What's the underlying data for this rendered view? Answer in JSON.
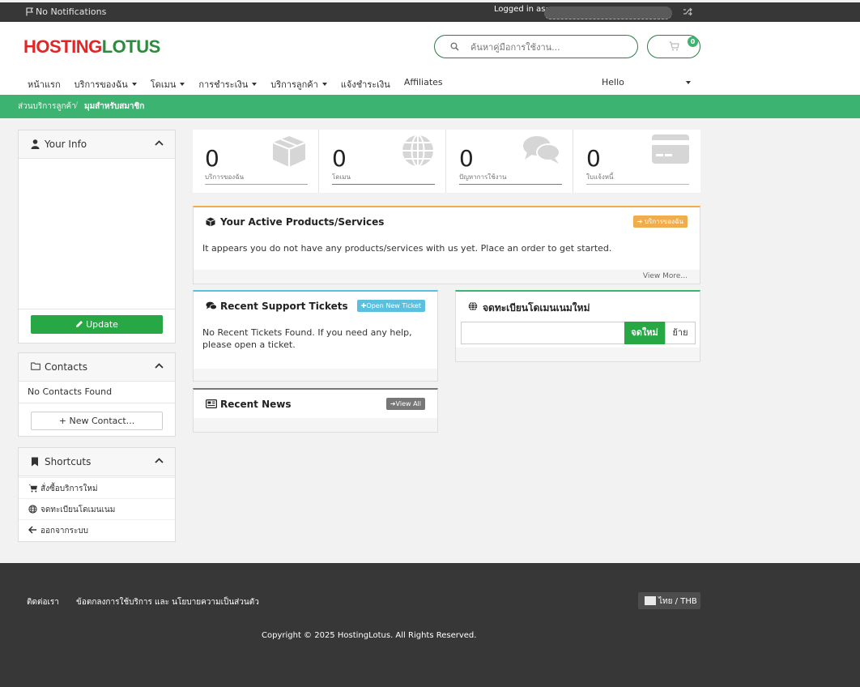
{
  "topbar": {
    "notifications": "No Notifications",
    "logged_in_as": "Logged in as:"
  },
  "brand": {
    "part1": "HOSTING",
    "part2": "LOTUS"
  },
  "search": {
    "placeholder": "ค้นหาคู่มือการใช้งาน..."
  },
  "cart": {
    "count": "0"
  },
  "nav": {
    "items": [
      {
        "label": "หน้าแรก",
        "dropdown": false
      },
      {
        "label": "บริการของฉัน",
        "dropdown": true
      },
      {
        "label": "โดเมน",
        "dropdown": true
      },
      {
        "label": "การชำระเงิน",
        "dropdown": true
      },
      {
        "label": "บริการลูกค้า",
        "dropdown": true
      },
      {
        "label": "แจ้งชำระเงิน",
        "dropdown": false
      },
      {
        "label": "Affiliates",
        "dropdown": false
      }
    ],
    "hello": "Hello"
  },
  "breadcrumb": {
    "parent": "ส่วนบริการลูกค้า",
    "current": "มุมสำหรับสมาชิก"
  },
  "sidebar": {
    "info": {
      "title": "Your Info",
      "update_label": "Update"
    },
    "contacts": {
      "title": "Contacts",
      "empty": "No Contacts Found",
      "new_label": "+ New Contact..."
    },
    "shortcuts": {
      "title": "Shortcuts",
      "items": [
        {
          "label": "สั่งซื้อบริการใหม่",
          "icon": "cart-icon"
        },
        {
          "label": "จดทะเบียนโดเมนเนม",
          "icon": "globe-icon"
        },
        {
          "label": "ออกจากระบบ",
          "icon": "arrow-left-icon"
        }
      ]
    }
  },
  "stats": [
    {
      "value": "0",
      "label": "บริการของฉัน",
      "color": "#5bc0de",
      "icon": "box-icon"
    },
    {
      "value": "0",
      "label": "โดเมน",
      "color": "#28a745",
      "icon": "globe-icon"
    },
    {
      "value": "0",
      "label": "ปัญหาการใช้งาน",
      "color": "#d9534f",
      "icon": "comments-icon"
    },
    {
      "value": "0",
      "label": "ใบแจ้งหนี้",
      "color": "#f0ad4e",
      "icon": "credit-card-icon"
    }
  ],
  "products": {
    "title": "Your Active Products/Services",
    "tag": "บริการของฉัน",
    "body": "It appears you do not have any products/services with us yet. Place an order to get started.",
    "view_more": "View More..."
  },
  "tickets": {
    "title": "Recent Support Tickets",
    "tag": "Open New Ticket",
    "body": "No Recent Tickets Found. If you need any help, please open a ticket."
  },
  "domain": {
    "title": "จดทะเบียนโดเมนเนมใหม่",
    "register_label": "จดใหม่",
    "transfer_label": "ย้าย"
  },
  "news": {
    "title": "Recent News",
    "tag": "View All"
  },
  "footer": {
    "contact": "ติดต่อเรา",
    "terms": "ข้อตกลงการใช้บริการ และ นโยบายความเป็นส่วนตัว",
    "language": "ไทย / THB",
    "copyright": "Copyright © 2025 HostingLotus. All Rights Reserved."
  },
  "colors": {
    "accent_green": "#3cb371",
    "button_green": "#28a745",
    "brand_red": "#e02626",
    "dark": "#373737"
  }
}
